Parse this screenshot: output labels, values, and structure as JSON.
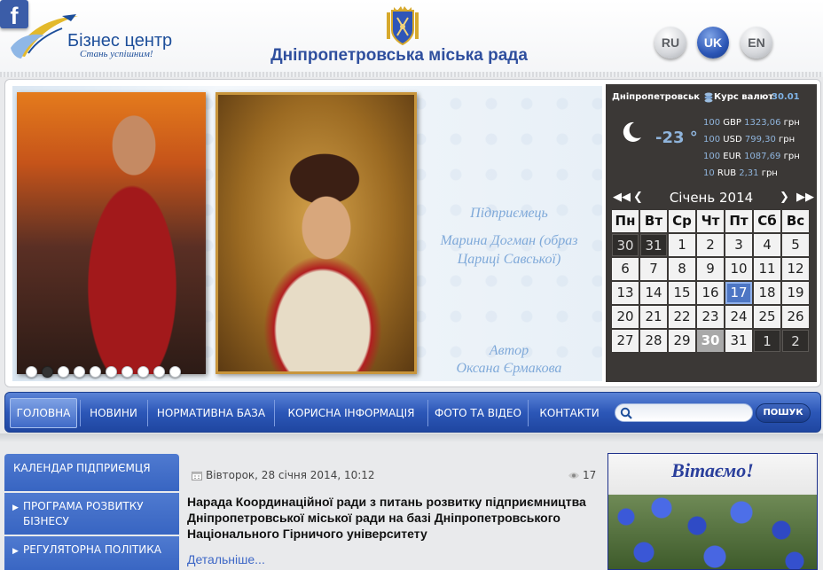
{
  "header": {
    "logo_title": "Бізнес центр",
    "logo_slogan": "Стань успішним!",
    "city_title": "Дніпропетровська міська рада",
    "social_facebook": "f",
    "languages": [
      "RU",
      "UK",
      "EN"
    ],
    "active_language": "UK"
  },
  "banner": {
    "caption_role": "Підприємець",
    "caption_name": "Марина Догман (образ Цариці Савської)",
    "caption_author_label": "Автор",
    "caption_author": "Оксана Єрмакова",
    "slide_count": 10,
    "active_slide": 2
  },
  "widget": {
    "city": "Дніпропетровськ",
    "rate_label": "Курс валют",
    "rate_date": "30.01",
    "temperature": "-23 °",
    "rates": [
      {
        "amount": "100",
        "currency": "GBP",
        "value": "1323,06",
        "unit": "грн"
      },
      {
        "amount": "100",
        "currency": "USD",
        "value": "799,30",
        "unit": "грн"
      },
      {
        "amount": "100",
        "currency": "EUR",
        "value": "1087,69",
        "unit": "грн"
      },
      {
        "amount": "10",
        "currency": "RUB",
        "value": "2,31",
        "unit": "грн"
      }
    ],
    "calendar_title": "Січень 2014",
    "weekdays": [
      "Пн",
      "Вт",
      "Ср",
      "Чт",
      "Пт",
      "Сб",
      "Вс"
    ],
    "days": [
      {
        "d": "30",
        "t": "other"
      },
      {
        "d": "31",
        "t": "other"
      },
      {
        "d": "1",
        "t": ""
      },
      {
        "d": "2",
        "t": ""
      },
      {
        "d": "3",
        "t": ""
      },
      {
        "d": "4",
        "t": ""
      },
      {
        "d": "5",
        "t": ""
      },
      {
        "d": "6",
        "t": ""
      },
      {
        "d": "7",
        "t": ""
      },
      {
        "d": "8",
        "t": ""
      },
      {
        "d": "9",
        "t": ""
      },
      {
        "d": "10",
        "t": ""
      },
      {
        "d": "11",
        "t": ""
      },
      {
        "d": "12",
        "t": ""
      },
      {
        "d": "13",
        "t": ""
      },
      {
        "d": "14",
        "t": ""
      },
      {
        "d": "15",
        "t": ""
      },
      {
        "d": "16",
        "t": ""
      },
      {
        "d": "17",
        "t": "today"
      },
      {
        "d": "18",
        "t": ""
      },
      {
        "d": "19",
        "t": ""
      },
      {
        "d": "20",
        "t": ""
      },
      {
        "d": "21",
        "t": ""
      },
      {
        "d": "22",
        "t": ""
      },
      {
        "d": "23",
        "t": ""
      },
      {
        "d": "24",
        "t": ""
      },
      {
        "d": "25",
        "t": ""
      },
      {
        "d": "26",
        "t": ""
      },
      {
        "d": "27",
        "t": ""
      },
      {
        "d": "28",
        "t": ""
      },
      {
        "d": "29",
        "t": ""
      },
      {
        "d": "30",
        "t": "selected"
      },
      {
        "d": "31",
        "t": ""
      },
      {
        "d": "1",
        "t": "other"
      },
      {
        "d": "2",
        "t": "other"
      }
    ]
  },
  "menu": {
    "items": [
      "ГОЛОВНА",
      "НОВИНИ",
      "НОРМАТИВНА БАЗА",
      "КОРИСНА ІНФОРМАЦІЯ",
      "ФОТО ТА ВІДЕО",
      "КОНТАКТИ"
    ],
    "search_value": "",
    "search_button": "ПОШУК"
  },
  "sidebar": {
    "items": [
      "КАЛЕНДАР ПІДПРИЄМЦЯ",
      "ПРОГРАМА РОЗВИТКУ БІЗНЕСУ",
      "РЕГУЛЯТОРНА ПОЛІТИКА"
    ]
  },
  "news": {
    "date": "Вівторок, 28 січня 2014, 10:12",
    "views": "17",
    "title": "Нарада Координаційної ради з питань розвитку підприємництва Дніпропетровської міської ради на базі Дніпропетровського Національного Гірничого університету",
    "more": "Детальніше..."
  },
  "greeting": {
    "text": "Вітаємо!"
  },
  "colors": {
    "brand_blue": "#2f4f9e",
    "menu_blue": "#2c57b8",
    "widget_bg": "#3b3836",
    "today_blue": "#4d76c4"
  }
}
